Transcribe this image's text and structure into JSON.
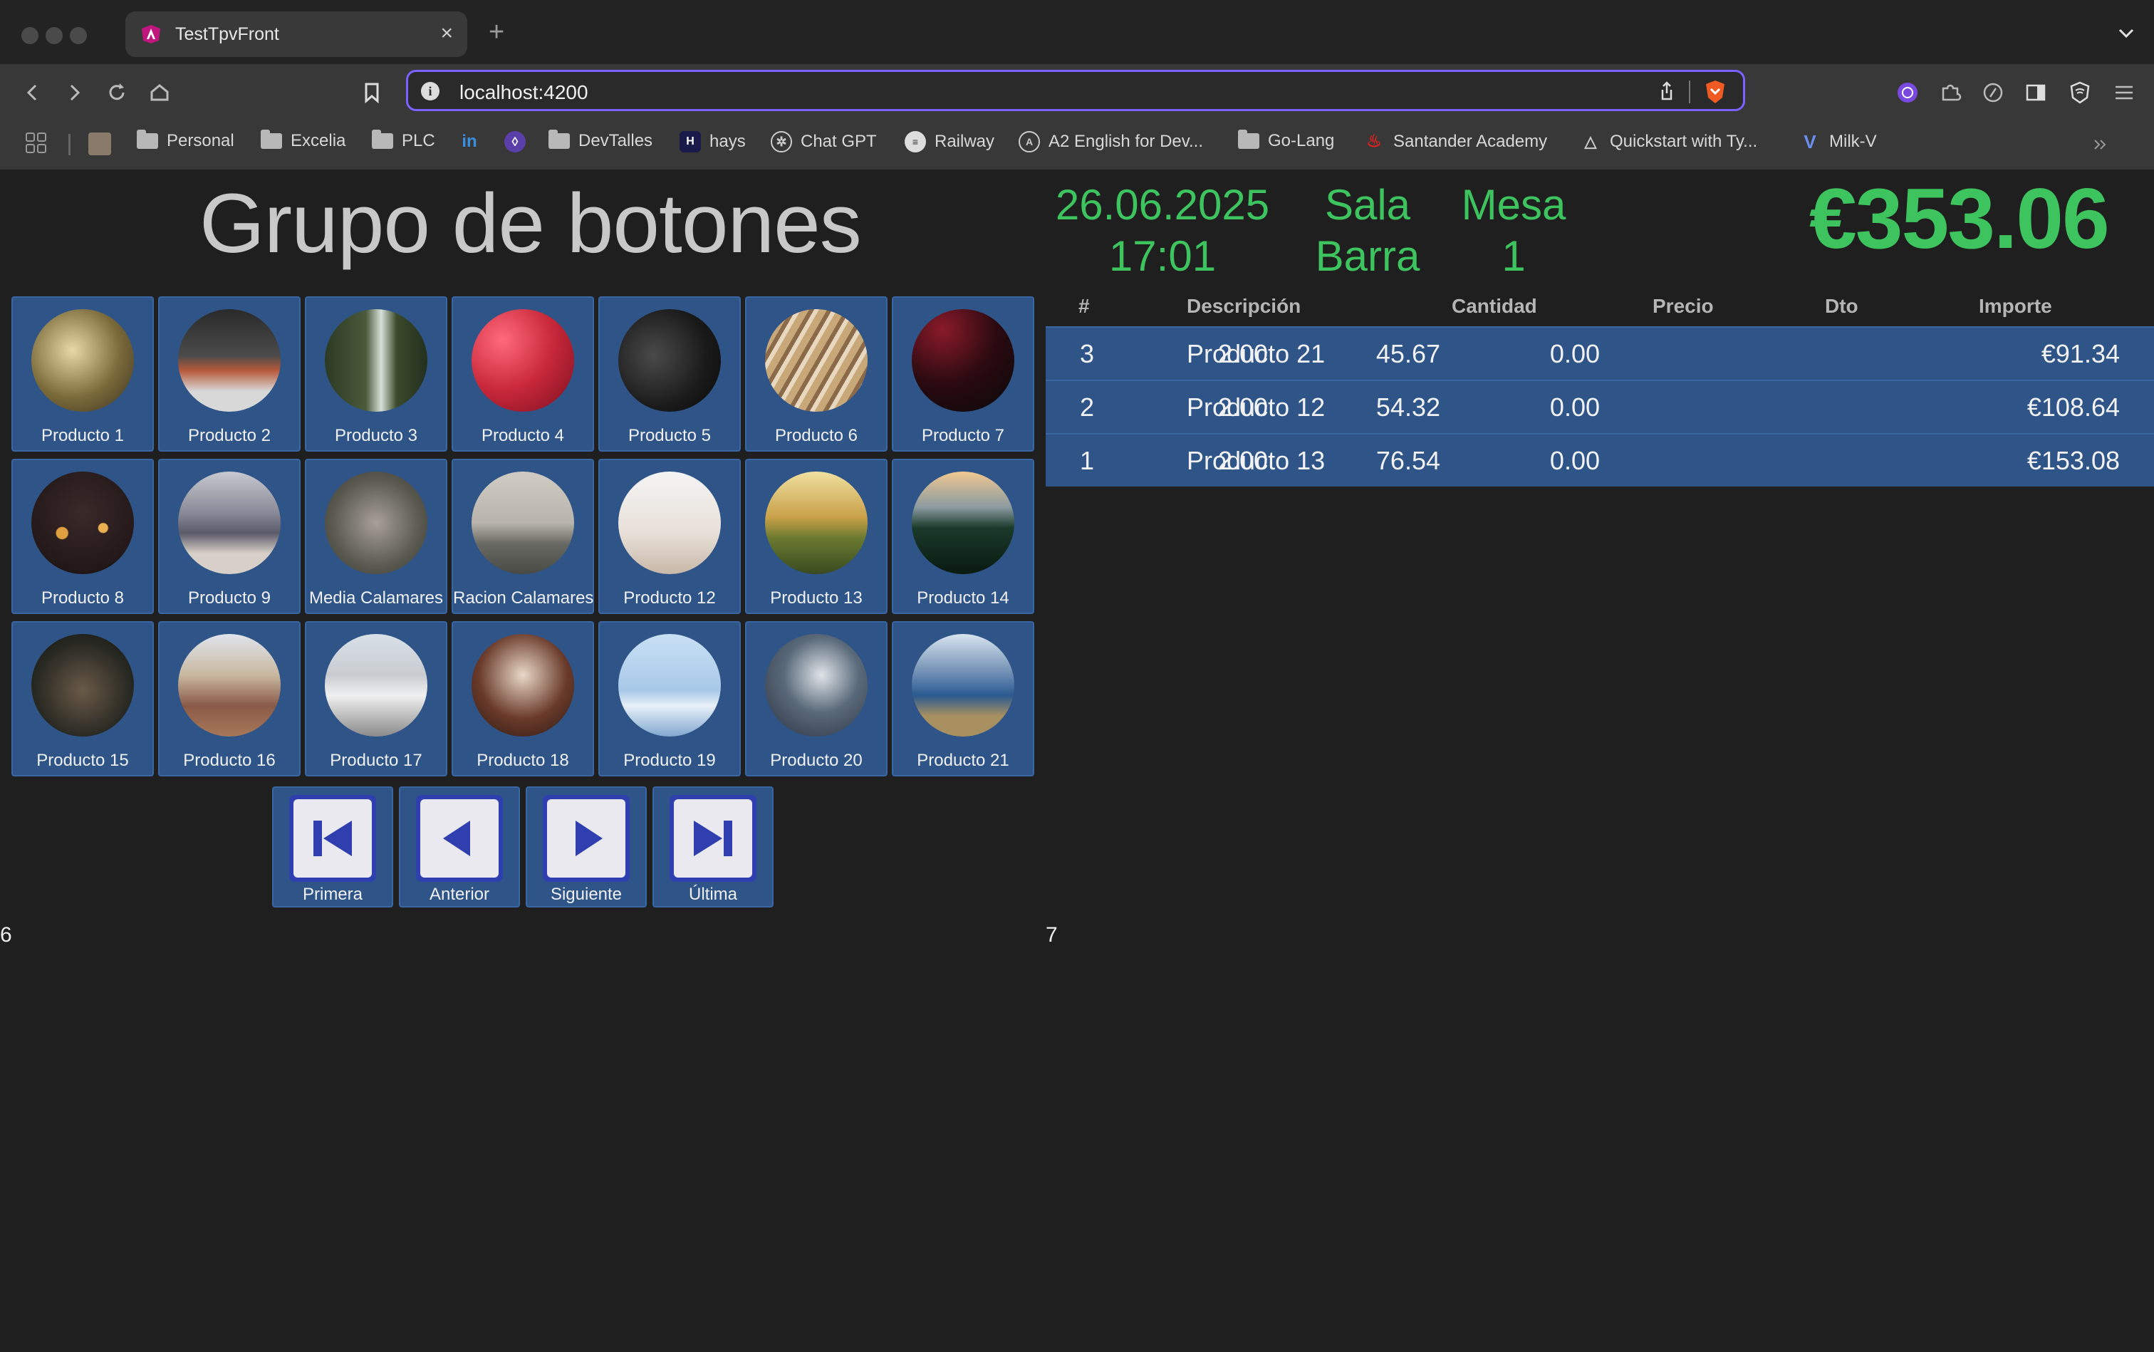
{
  "browser": {
    "tab_title": "TestTpvFront",
    "url": "localhost:4200",
    "bookmarks": [
      "Personal",
      "Excelia",
      "PLC",
      "DevTalles",
      "hays",
      "Chat GPT",
      "Railway",
      "A2 English for Dev...",
      "Go-Lang",
      "Santander Academy",
      "Quickstart with Ty...",
      "Milk-V"
    ]
  },
  "header": {
    "title": "Grupo de botones",
    "date": "26.06.2025",
    "time": "17:01",
    "sala_label": "Sala",
    "sala_value": "Barra",
    "mesa_label": "Mesa",
    "mesa_value": "1",
    "total": "€353.06"
  },
  "products": [
    "Producto 1",
    "Producto 2",
    "Producto 3",
    "Producto 4",
    "Producto 5",
    "Producto 6",
    "Producto 7",
    "Producto 8",
    "Producto 9",
    "Media Calamares",
    "Racion Calamares",
    "Producto 12",
    "Producto 13",
    "Producto 14",
    "Producto 15",
    "Producto 16",
    "Producto 17",
    "Producto 18",
    "Producto 19",
    "Producto 20",
    "Producto 21"
  ],
  "pager": {
    "first": "Primera",
    "prev": "Anterior",
    "next": "Siguiente",
    "last": "Última"
  },
  "footer": {
    "left_number": "6",
    "right_number": "7"
  },
  "ticket": {
    "headers": [
      "#",
      "Descripción",
      "Cantidad",
      "Precio",
      "Dto",
      "Importe"
    ],
    "rows": [
      [
        "3",
        "Producto 21",
        "2.00",
        "45.67",
        "0.00",
        "€91.34"
      ],
      [
        "2",
        "Producto 12",
        "2.00",
        "54.32",
        "0.00",
        "€108.64"
      ],
      [
        "1",
        "Producto 13",
        "2.00",
        "76.54",
        "0.00",
        "€153.08"
      ]
    ]
  },
  "colors": {
    "accent_green": "#3ec45f",
    "tile_blue": "#2e5488",
    "background": "#1f1f1f"
  }
}
